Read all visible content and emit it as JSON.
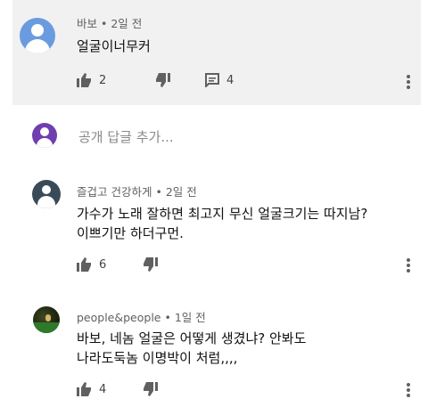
{
  "comments": [
    {
      "author": "바보",
      "time": "2일 전",
      "lines": [
        "얼굴이너무커"
      ],
      "likes": "2",
      "replies": "4",
      "avatar": "default-avatar-blue"
    },
    {
      "author": "즐겁고 건강하게",
      "time": "2일 전",
      "lines": [
        "가수가 노래 잘하면 최고지 무신 얼굴크기는 따지남?",
        "이쁘기만 하더구먼."
      ],
      "likes": "6",
      "avatar": "default-avatar-slate"
    },
    {
      "author": "people&people",
      "time": "1일 전",
      "lines": [
        "바보, 네놈 얼굴은 어떻게  생겼냐?  안봐도",
        "나라도둑놈  이명박이 처럼,,,,"
      ],
      "likes": "4",
      "avatar": "photo-avatar"
    }
  ],
  "reply_box": {
    "placeholder": "공개 답글 추가..."
  },
  "colors": {
    "highlight_bg": "#f1f1f1",
    "icon": "#606060",
    "meta_text": "#606060"
  },
  "icons": [
    "thumbs-up-icon",
    "thumbs-down-icon",
    "comment-icon",
    "more-vert-icon"
  ]
}
